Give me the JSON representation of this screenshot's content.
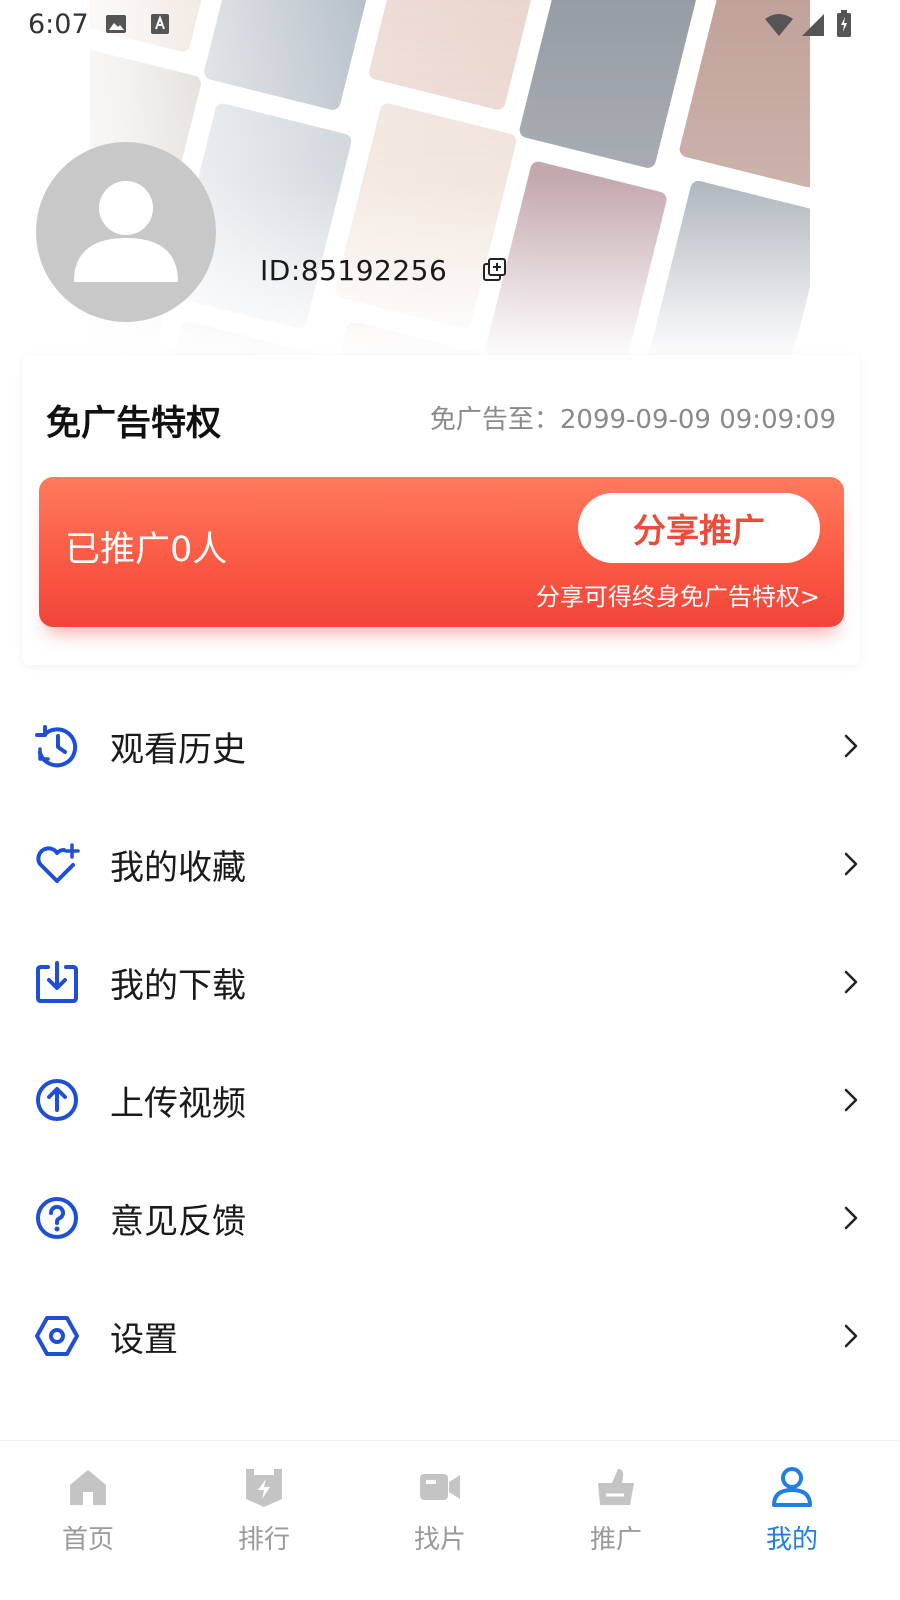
{
  "status_bar": {
    "time": "6:07",
    "icons": [
      "image-icon",
      "text-a-icon",
      "wifi-icon",
      "signal-icon",
      "battery-charging-icon"
    ]
  },
  "profile": {
    "id_text": "ID:85192256",
    "avatar_icon": "default-user-avatar-icon",
    "copy_icon": "copy-icon"
  },
  "ad_free": {
    "title": "免广告特权",
    "expire_text": "免广告至：2099-09-09 09:09:09",
    "promoted_count_text": "已推广0人",
    "share_button": "分享推广",
    "share_hint": "分享可得终身免广告特权>"
  },
  "menu": {
    "items": [
      {
        "label": "观看历史",
        "icon": "history-icon"
      },
      {
        "label": "我的收藏",
        "icon": "heart-plus-icon"
      },
      {
        "label": "我的下载",
        "icon": "download-icon"
      },
      {
        "label": "上传视频",
        "icon": "upload-icon"
      },
      {
        "label": "意见反馈",
        "icon": "question-icon"
      },
      {
        "label": "设置",
        "icon": "settings-hex-icon"
      }
    ]
  },
  "bottom_nav": {
    "items": [
      {
        "label": "首页",
        "icon": "home-icon",
        "active": false
      },
      {
        "label": "排行",
        "icon": "ranking-icon",
        "active": false
      },
      {
        "label": "找片",
        "icon": "video-camera-icon",
        "active": false
      },
      {
        "label": "推广",
        "icon": "thumbs-up-icon",
        "active": false
      },
      {
        "label": "我的",
        "icon": "user-icon",
        "active": true
      }
    ]
  },
  "colors": {
    "accent_blue": "#1f4fd6",
    "nav_active": "#1f7fe5",
    "promo_red": "#f4493b",
    "nav_inactive": "#c0c0c0"
  }
}
